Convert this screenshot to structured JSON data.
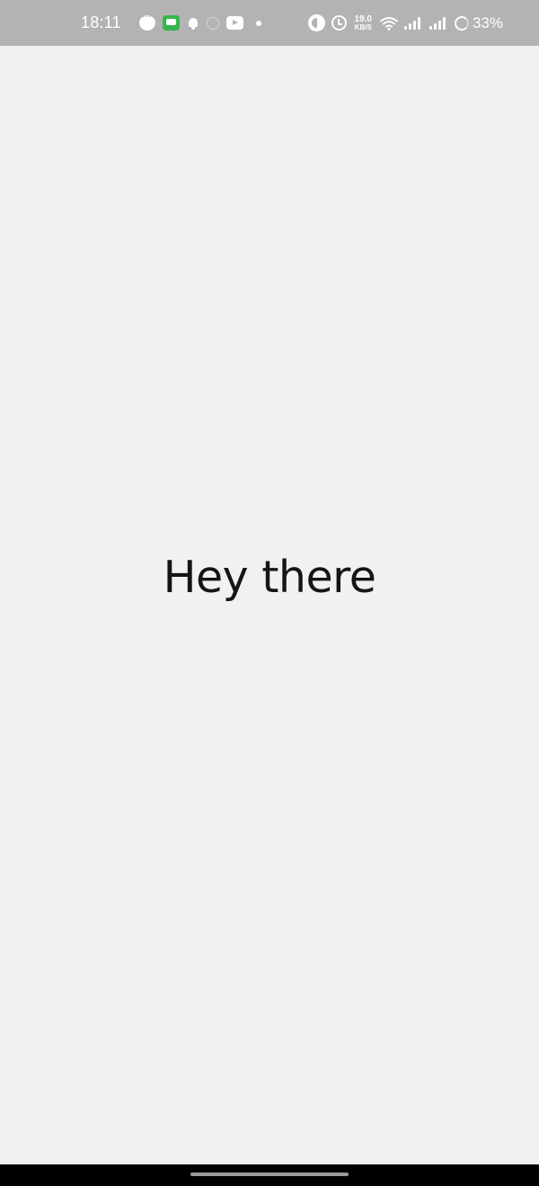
{
  "status_bar": {
    "time": "18:11",
    "network_speed_value": "19.0",
    "network_speed_unit": "KB/S",
    "battery_percent": "33%",
    "notification_icons": [
      "chat-bubble-icon",
      "messages-icon",
      "bell-icon",
      "app-icon",
      "video-icon",
      "dot-icon"
    ],
    "system_icons": [
      "data-saver-icon",
      "alarm-icon",
      "wifi-icon",
      "signal-icon",
      "signal-icon",
      "battery-icon"
    ]
  },
  "main": {
    "greeting": "Hey there"
  },
  "colors": {
    "status_bar_bg": "#b3b3b3",
    "page_bg": "#f2f0f1",
    "text": "#151515",
    "nav_bar_bg": "#000000"
  }
}
